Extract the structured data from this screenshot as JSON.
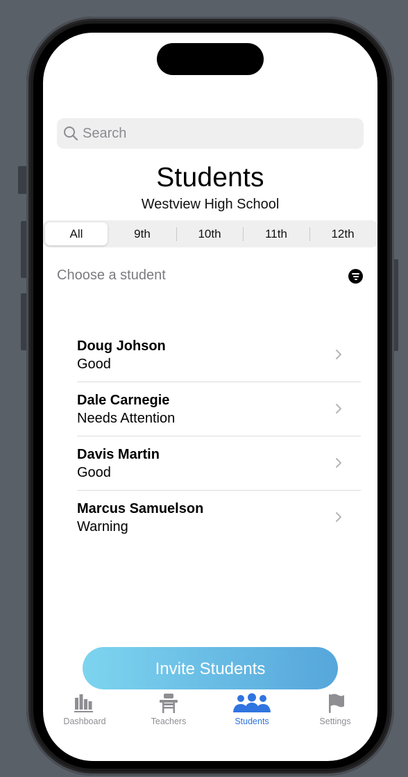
{
  "search": {
    "placeholder": "Search"
  },
  "header": {
    "title": "Students",
    "subtitle": "Westview High School"
  },
  "grades": {
    "selected": "All",
    "options": [
      "All",
      "9th",
      "10th",
      "11th",
      "12th"
    ]
  },
  "list_header": {
    "label": "Choose a student",
    "icon": "filter-icon"
  },
  "students": [
    {
      "name": "Doug Johson",
      "status": "Good"
    },
    {
      "name": "Dale Carnegie",
      "status": "Needs Attention"
    },
    {
      "name": "Davis Martin",
      "status": "Good"
    },
    {
      "name": "Marcus Samuelson",
      "status": "Warning"
    }
  ],
  "invite_button": {
    "label": "Invite Students"
  },
  "tabs": [
    {
      "label": "Dashboard",
      "icon": "books-icon"
    },
    {
      "label": "Teachers",
      "icon": "desk-icon"
    },
    {
      "label": "Students",
      "icon": "people-icon",
      "active": true
    },
    {
      "label": "Settings",
      "icon": "flag-icon"
    }
  ],
  "colors": {
    "accent": "#2f74e0",
    "inactive_tab": "#8e8e93",
    "invite_gradient_start": "#7dd4ef",
    "invite_gradient_end": "#56a6db"
  }
}
